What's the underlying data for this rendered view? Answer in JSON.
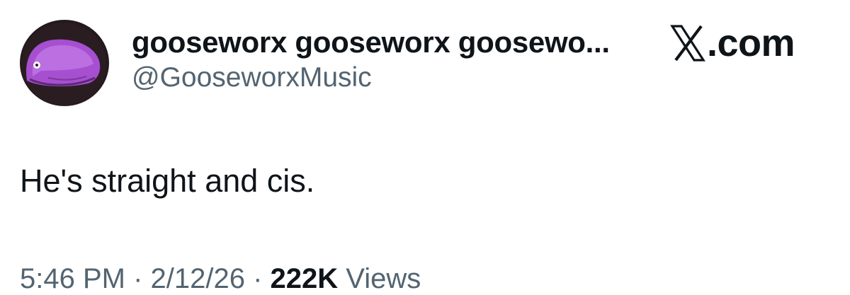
{
  "author": {
    "display_name": "gooseworx gooseworx goosewo...",
    "handle": "@GooseworxMusic"
  },
  "brand": {
    "text": ".com",
    "icon": "x-logo-icon"
  },
  "tweet": {
    "text": "He's straight and cis."
  },
  "meta": {
    "time": "5:46 PM",
    "separator": " · ",
    "date": "2/12/26",
    "views_count": "222K",
    "views_label": " Views"
  },
  "colors": {
    "avatar_purple": "#b15ad6",
    "text_primary": "#0f1419",
    "text_secondary": "#536471"
  }
}
